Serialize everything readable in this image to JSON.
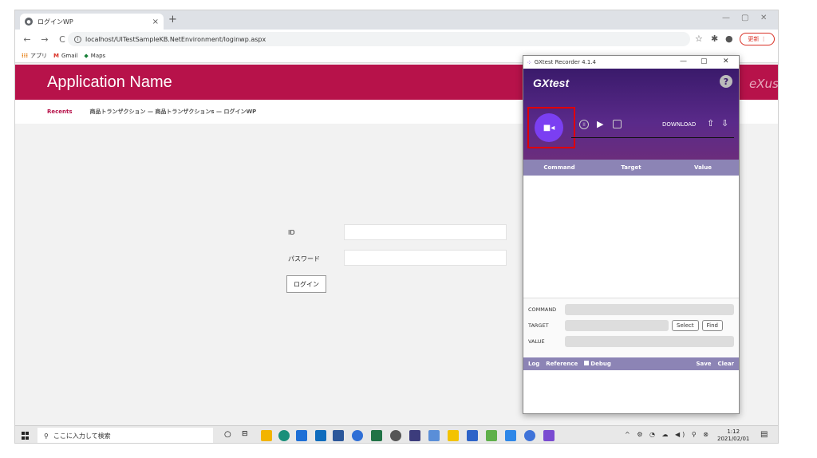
{
  "browser": {
    "tab_title": "ログインWP",
    "tab_close": "×",
    "new_tab": "+",
    "url": "localhost/UITestSampleKB.NetEnvironment/loginwp.aspx",
    "update_label": "更新 ⋮",
    "bookmarks": [
      {
        "icon": "apps-icon",
        "label": "アプリ"
      },
      {
        "icon": "gmail-icon",
        "label": "Gmail"
      },
      {
        "icon": "maps-icon",
        "label": "Maps"
      }
    ]
  },
  "app": {
    "title": "Application Name",
    "brand_partial": "eXus",
    "recents_label": "Recents",
    "breadcrumb": "商品トランザクション — 商品トランザクションs — ログインWP"
  },
  "login": {
    "id_label": "ID",
    "password_label": "パスワード",
    "id_value": "",
    "password_value": "",
    "button_label": "ログイン"
  },
  "recorder": {
    "window_title": "GXtest Recorder 4.1.4",
    "logo": "GXtest",
    "help": "?",
    "download_label": "DOWNLOAD",
    "columns": [
      "Command",
      "Target",
      "Value"
    ],
    "command_label": "COMMAND",
    "target_label": "TARGET",
    "value_label": "VALUE",
    "select_label": "Select",
    "find_label": "Find",
    "tabs": {
      "log": "Log",
      "reference": "Reference",
      "debug": "Debug",
      "save": "Save",
      "clear": "Clear"
    }
  },
  "taskbar": {
    "search_placeholder": "ここに入力して検索",
    "time": "1:12",
    "date": "2021/02/01"
  },
  "colors": {
    "brand": "#b7124a",
    "recorder_accent": "#7b3ff2",
    "recorder_header": "#8c84b5"
  }
}
